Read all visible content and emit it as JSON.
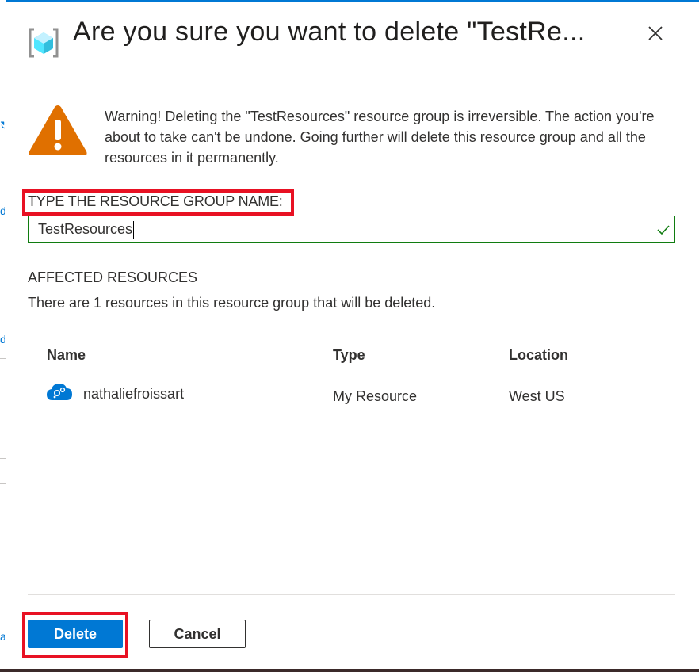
{
  "dialog": {
    "title": "Are you sure you want to delete \"TestRe...",
    "close_icon": "close-icon",
    "resource_group_icon": "resource-group-icon"
  },
  "warning": {
    "icon": "warning-icon",
    "text": "Warning! Deleting the \"TestResources\" resource group is irreversible. The action you're about to take can't be undone. Going further will delete this resource group and all the resources in it permanently."
  },
  "confirm": {
    "label": "TYPE THE RESOURCE GROUP NAME:",
    "value": "TestResources",
    "valid_icon": "checkmark-icon"
  },
  "affected": {
    "title": "AFFECTED RESOURCES",
    "description": "There are 1 resources in this resource group that will be deleted.",
    "columns": [
      "Name",
      "Type",
      "Location"
    ],
    "rows": [
      {
        "name": "nathaliefroissart",
        "type": "My Resource",
        "location": "West US",
        "icon": "cloud-service-icon"
      }
    ]
  },
  "buttons": {
    "delete": "Delete",
    "cancel": "Cancel"
  },
  "colors": {
    "accent": "#0078d4",
    "highlight": "#e81123",
    "warning": "#e07000",
    "valid": "#107c10"
  }
}
